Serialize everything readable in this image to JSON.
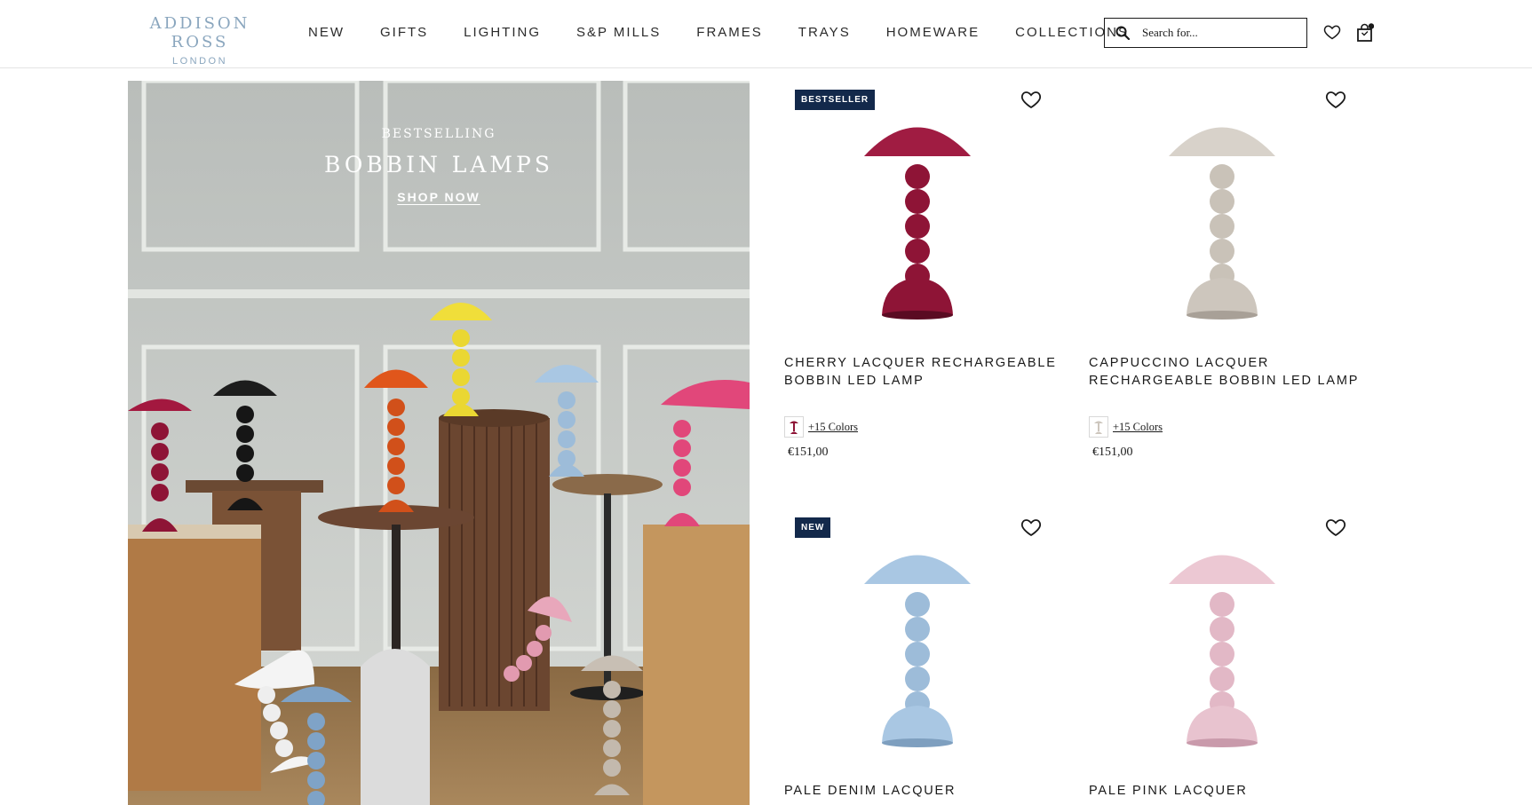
{
  "header": {
    "logo_main": "ADDISON ROSS",
    "logo_sub": "LONDON",
    "nav": [
      "NEW",
      "GIFTS",
      "LIGHTING",
      "S&P MILLS",
      "FRAMES",
      "TRAYS",
      "HOMEWARE",
      "COLLECTIONS"
    ],
    "search_placeholder": "Search for..."
  },
  "hero": {
    "eyebrow": "BESTSELLING",
    "title": "BOBBIN LAMPS",
    "cta": "SHOP NOW"
  },
  "products": [
    {
      "badge": "BESTSELLER",
      "title": "CHERRY LACQUER RECHARGEABLE BOBBIN LED LAMP",
      "colors": "+15 Colors",
      "price": "€151,00",
      "color": "#8e1436"
    },
    {
      "badge": "",
      "title": "CAPPUCCINO LACQUER RECHARGEABLE BOBBIN LED LAMP",
      "colors": "+15 Colors",
      "price": "€151,00",
      "color": "#cdc6bd"
    },
    {
      "badge": "NEW",
      "title": "PALE DENIM LACQUER",
      "colors": "",
      "price": "",
      "color": "#a9c7e3"
    },
    {
      "badge": "",
      "title": "PALE PINK LACQUER",
      "colors": "",
      "price": "",
      "color": "#e8c3cf"
    }
  ],
  "colors": {
    "badge_bg": "#13294b",
    "logo": "#8aa6be"
  }
}
